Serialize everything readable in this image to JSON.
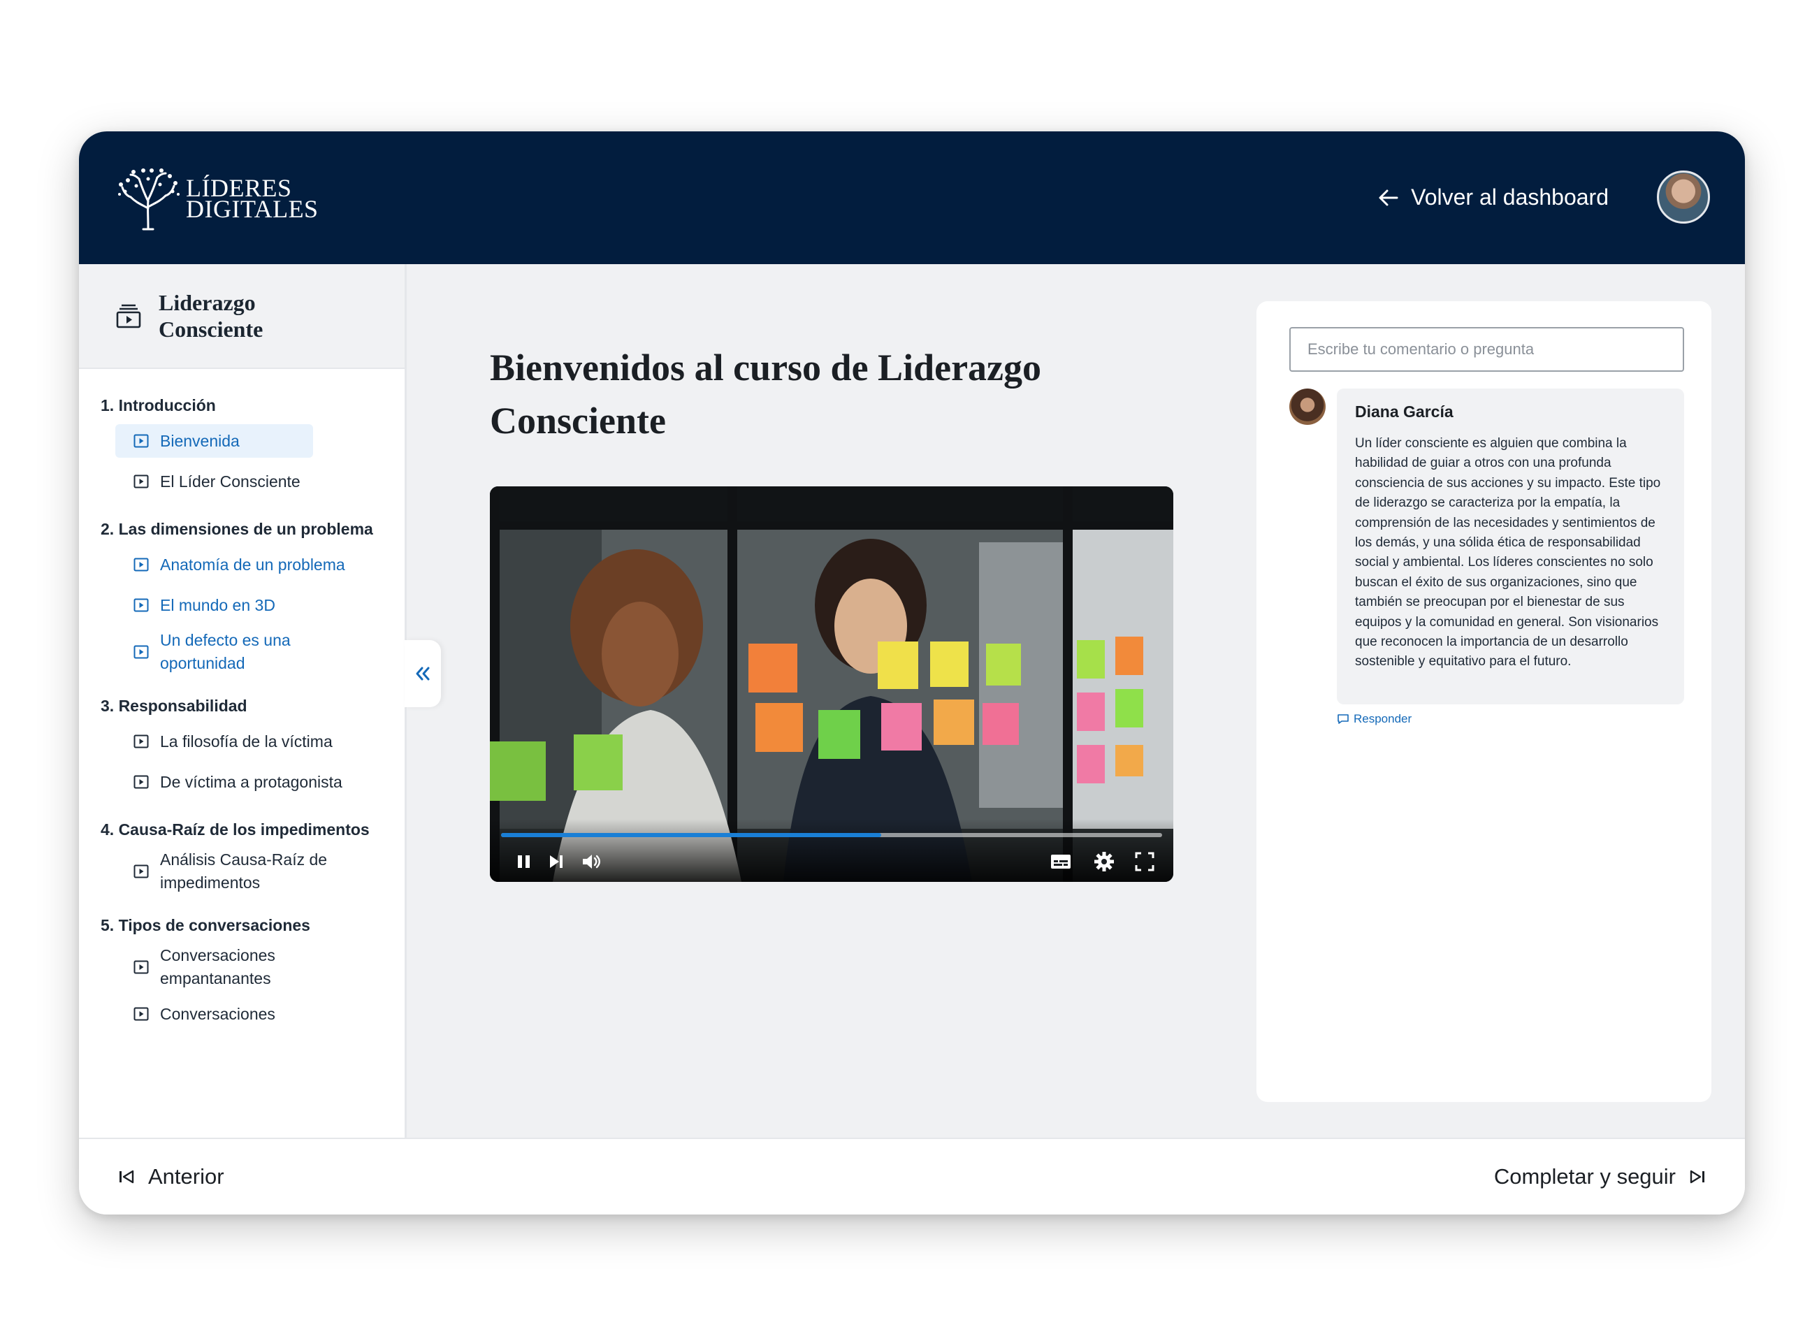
{
  "header": {
    "logo_line1": "LÍDERES",
    "logo_line2": "DIGITALES",
    "back_label": "Volver al dashboard"
  },
  "sidebar": {
    "course_title": "Liderazgo Consciente",
    "modules": [
      {
        "title": "1. Introducción",
        "lessons": [
          "Bienvenida",
          "El Líder Consciente"
        ]
      },
      {
        "title": "2. Las dimensiones de un problema",
        "lessons": [
          "Anatomía de un problema",
          "El mundo en 3D",
          "Un defecto es una oportunidad"
        ]
      },
      {
        "title": "3. Responsabilidad",
        "lessons": [
          "La filosofía de la víctima",
          "De víctima a protagonista"
        ]
      },
      {
        "title": "4. Causa-Raíz de los impedimentos",
        "lessons": [
          "Análisis Causa-Raíz de impedimentos"
        ]
      },
      {
        "title": "5. Tipos de conversaciones",
        "lessons": [
          "Conversaciones empantanantes",
          "Conversaciones"
        ]
      }
    ]
  },
  "main": {
    "title": "Bienvenidos al curso de Liderazgo Consciente"
  },
  "video": {
    "progress": 0.575
  },
  "comments": {
    "placeholder": "Escribe tu comentario o pregunta",
    "author": "Diana García",
    "text": "Un líder consciente es alguien que combina la habilidad de guiar a otros con una profunda consciencia de sus acciones y su impacto. Este tipo de liderazgo se caracteriza por la empatía, la comprensión de las necesidades y sentimientos de los demás, y una sólida ética de responsabilidad social y ambiental. Los líderes conscientes no solo buscan el éxito de sus organizaciones, sino que también se preocupan por el bienestar de sus equipos y la comunidad en general. Son visionarios que reconocen la importancia de un desarrollo sostenible y equitativo para el futuro.",
    "reply_label": "Responder"
  },
  "footer": {
    "prev_label": "Anterior",
    "next_label": "Completar y seguir"
  },
  "colors": {
    "header_bg": "#021d3e",
    "link": "#1469b8",
    "progress": "#1a7fd6"
  }
}
